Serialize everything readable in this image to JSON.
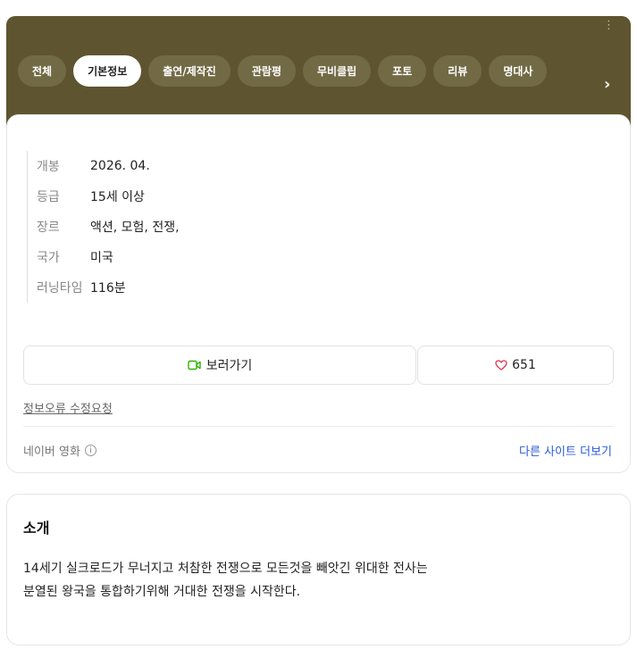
{
  "header": {
    "tabs": [
      {
        "label": "전체",
        "active": false
      },
      {
        "label": "기본정보",
        "active": true
      },
      {
        "label": "출연/제작진",
        "active": false
      },
      {
        "label": "관람평",
        "active": false
      },
      {
        "label": "무비클립",
        "active": false
      },
      {
        "label": "포토",
        "active": false
      },
      {
        "label": "리뷰",
        "active": false
      },
      {
        "label": "명대사",
        "active": false
      }
    ],
    "more_icon": "vertical-dots-icon",
    "next_icon": "chevron-right-icon"
  },
  "info": {
    "rows": [
      {
        "label": "개봉",
        "value": "2026. 04."
      },
      {
        "label": "등급",
        "value": "15세 이상"
      },
      {
        "label": "장르",
        "value": "액션, 모험, 전쟁,"
      },
      {
        "label": "국가",
        "value": "미국"
      },
      {
        "label": "러닝타임",
        "value": "116분"
      }
    ]
  },
  "actions": {
    "watch_label": "보러가기",
    "like_count": "651",
    "accent_green": "#2db400",
    "accent_red": "#e0344a"
  },
  "footer": {
    "report_label": "정보오류 수정요청",
    "source_label": "네이버 영화",
    "more_sites_label": "다른 사이트 더보기"
  },
  "intro": {
    "title": "소개",
    "line1": "14세기 실크로드가 무너지고 처참한 전쟁으로 모든것을 빼앗긴 위대한 전사는",
    "line2": "분열된 왕국을 통합하기위해 거대한 전쟁을 시작한다."
  },
  "colors": {
    "header_bg": "#5e5530",
    "tab_bg": "#726a45",
    "link_blue": "#2a5bd7"
  }
}
